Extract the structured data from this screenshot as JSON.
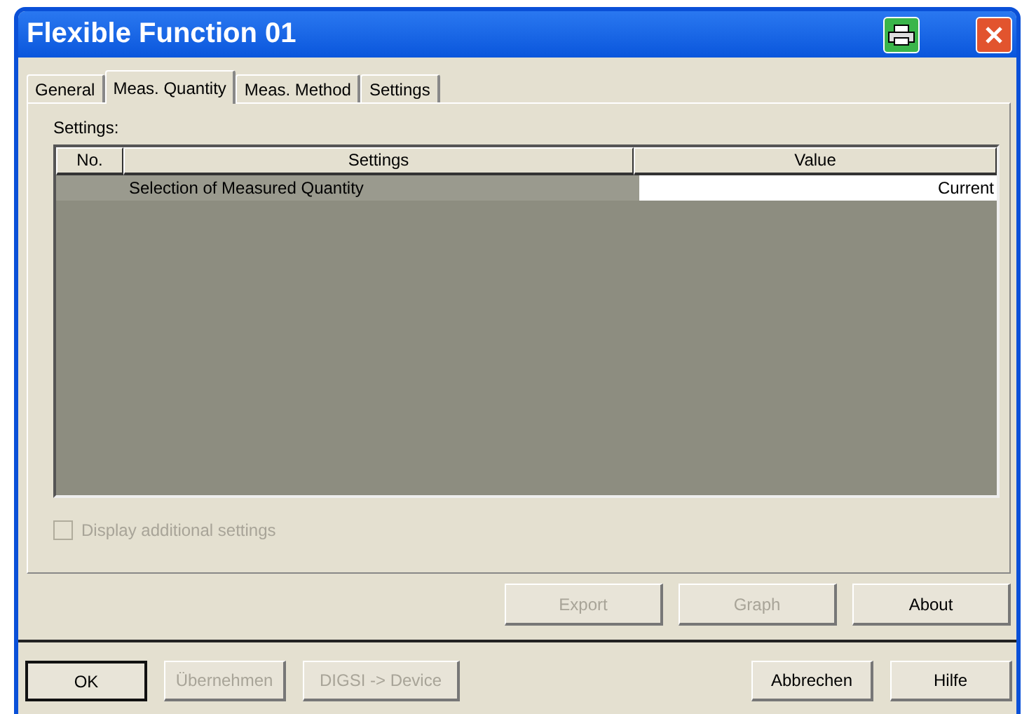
{
  "window": {
    "title": "Flexible Function 01"
  },
  "tabs": [
    {
      "label": "General",
      "selected": false
    },
    {
      "label": "Meas. Quantity",
      "selected": true
    },
    {
      "label": "Meas. Method",
      "selected": false
    },
    {
      "label": "Settings",
      "selected": false
    }
  ],
  "settings_label": "Settings:",
  "table": {
    "columns": [
      "No.",
      "Settings",
      "Value"
    ],
    "rows": [
      {
        "cells": [
          "",
          "Selection of Measured Quantity",
          "Current"
        ]
      }
    ]
  },
  "checkbox": {
    "label": "Display additional settings",
    "checked": false,
    "disabled": true
  },
  "panel_buttons": [
    {
      "label": "Export",
      "disabled": true
    },
    {
      "label": "Graph",
      "disabled": true
    },
    {
      "label": "About",
      "disabled": false
    }
  ],
  "dialog_buttons_left": [
    {
      "label": "OK",
      "disabled": false,
      "default": true
    },
    {
      "label": "Übernehmen",
      "disabled": true,
      "default": false
    },
    {
      "label": "DIGSI -> Device",
      "disabled": true,
      "default": false
    }
  ],
  "dialog_buttons_right": [
    {
      "label": "Abbrechen",
      "disabled": false,
      "default": false
    },
    {
      "label": "Hilfe",
      "disabled": false,
      "default": false
    }
  ]
}
